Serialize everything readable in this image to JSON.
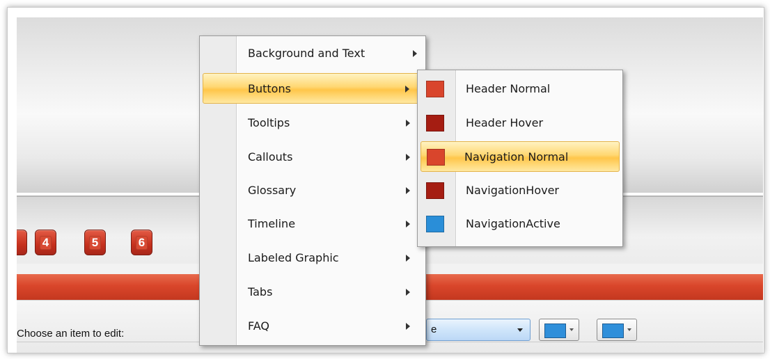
{
  "nav_buttons": [
    "4",
    "5",
    "6"
  ],
  "editor": {
    "choose_label": "Choose an item to edit:",
    "select_value_partial": "e",
    "color_pickers": [
      "#2f8fda",
      "#2f8fda"
    ]
  },
  "main_menu": {
    "items": [
      {
        "label": "Background and Text",
        "has_submenu": true
      },
      {
        "label": "Buttons",
        "has_submenu": true,
        "highlighted": true
      },
      {
        "label": "Tooltips",
        "has_submenu": true
      },
      {
        "label": "Callouts",
        "has_submenu": true
      },
      {
        "label": "Glossary",
        "has_submenu": true
      },
      {
        "label": "Timeline",
        "has_submenu": true
      },
      {
        "label": "Labeled Graphic",
        "has_submenu": true
      },
      {
        "label": "Tabs",
        "has_submenu": true
      },
      {
        "label": "FAQ",
        "has_submenu": true
      }
    ]
  },
  "buttons_submenu": {
    "items": [
      {
        "label": "Header Normal",
        "color": "#d9452c"
      },
      {
        "label": "Header Hover",
        "color": "#a51d12"
      },
      {
        "label": "Navigation Normal",
        "color": "#d9452c",
        "highlighted": true
      },
      {
        "label": "NavigationHover",
        "color": "#a51d12"
      },
      {
        "label": "NavigationActive",
        "color": "#2a8ed8"
      }
    ]
  },
  "colors": {
    "accent_red": "#d9452c",
    "highlight_gold": "#ffd772"
  }
}
